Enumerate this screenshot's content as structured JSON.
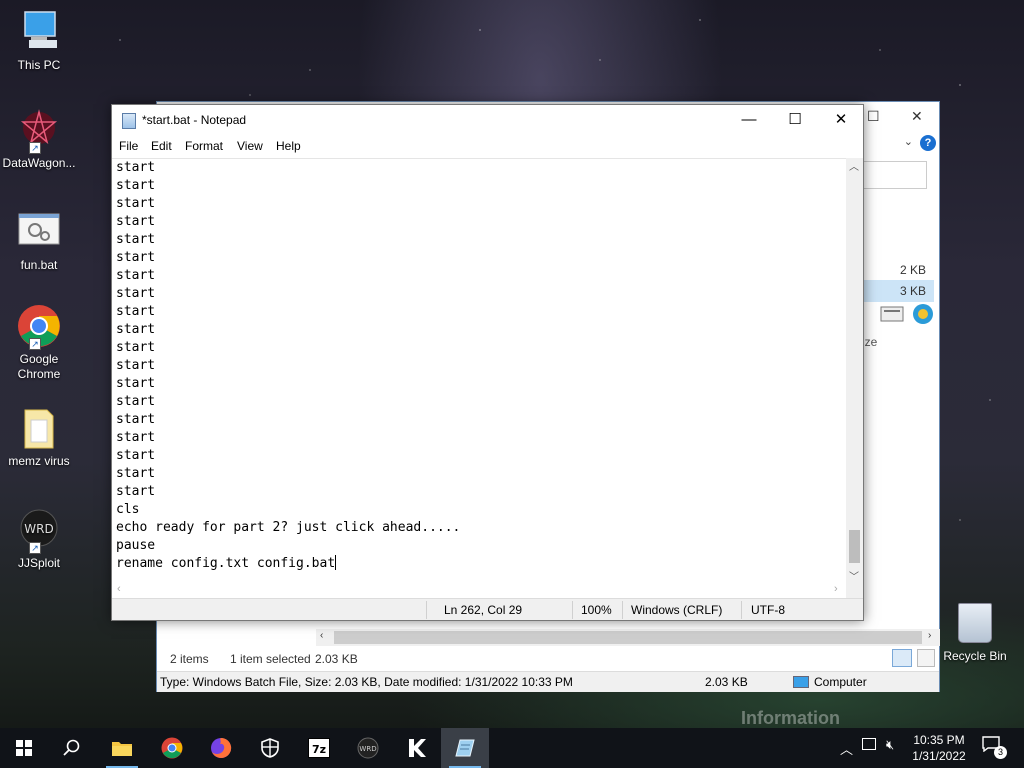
{
  "desktop": {
    "icons": [
      {
        "label": "This PC"
      },
      {
        "label": "DataWagon..."
      },
      {
        "label": "fun.bat"
      },
      {
        "label": "Google Chrome"
      },
      {
        "label": "memz virus"
      },
      {
        "label": "JJSploit"
      }
    ],
    "recycle_bin": "Recycle Bin",
    "watermark": "Information"
  },
  "explorer": {
    "column_size": "ize",
    "rows": [
      {
        "size": "2 KB"
      },
      {
        "size": "3 KB"
      }
    ],
    "status": {
      "items": "2 items",
      "selected": "1 item selected",
      "selected_size": "2.03 KB"
    },
    "bottombar": {
      "details": "Type: Windows Batch File, Size: 2.03 KB, Date modified: 1/31/2022 10:33 PM",
      "size": "2.03 KB",
      "location": "Computer"
    }
  },
  "notepad": {
    "title": "*start.bat - Notepad",
    "menu": [
      "File",
      "Edit",
      "Format",
      "View",
      "Help"
    ],
    "lines": [
      "start",
      "start",
      "start",
      "start",
      "start",
      "start",
      "start",
      "start",
      "start",
      "start",
      "start",
      "start",
      "start",
      "start",
      "start",
      "start",
      "start",
      "start",
      "start",
      "cls",
      "echo ready for part 2? just click ahead.....",
      "pause",
      "rename config.txt config.bat"
    ],
    "status": {
      "position": "Ln 262, Col 29",
      "zoom": "100%",
      "line_endings": "Windows (CRLF)",
      "encoding": "UTF-8"
    }
  },
  "taskbar": {
    "apps": [
      "Start",
      "Search",
      "File Explorer",
      "Google Chrome",
      "Firefox",
      "Windows Security",
      "7-Zip",
      "JJSploit",
      "Krnl",
      "Notepad"
    ],
    "clock": {
      "time": "10:35 PM",
      "date": "1/31/2022"
    },
    "notifications": "3"
  }
}
